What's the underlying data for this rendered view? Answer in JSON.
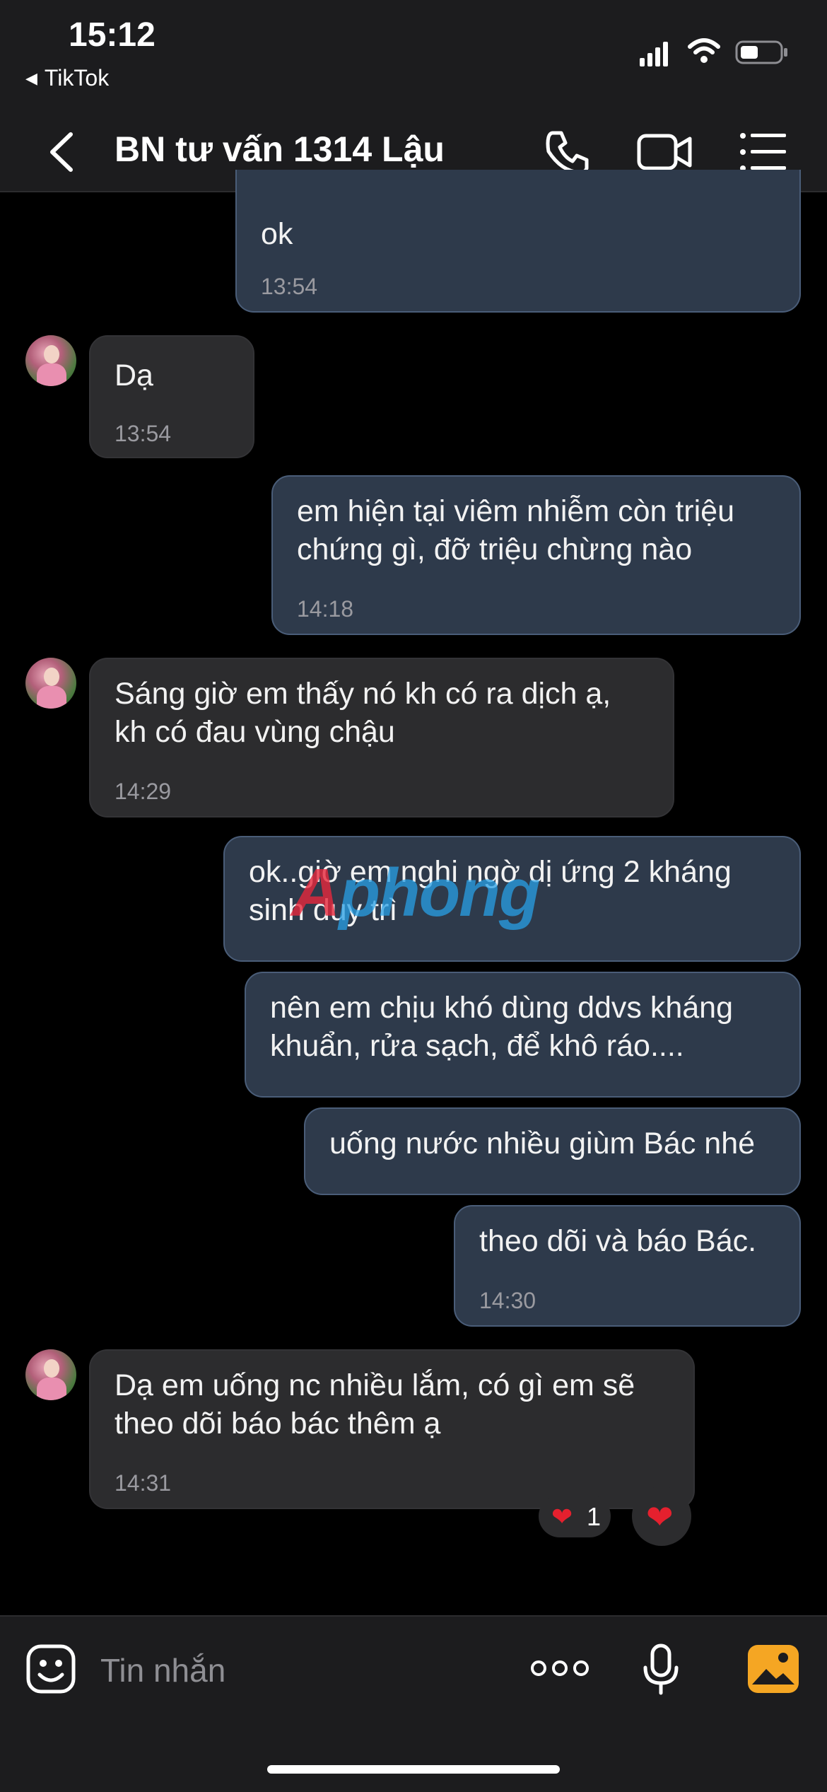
{
  "status_bar": {
    "time": "15:12",
    "back_app": "TikTok",
    "icons": [
      "cellular-signal-icon",
      "wifi-icon",
      "battery-icon"
    ]
  },
  "header": {
    "title": "BN tư vấn 1314 Lậu",
    "icons": [
      "back-chevron-icon",
      "phone-icon",
      "video-camera-icon",
      "list-menu-icon"
    ]
  },
  "messages": [
    {
      "sender": "me",
      "text": "ok",
      "time": "13:54"
    },
    {
      "sender": "contact",
      "text": "Dạ",
      "time": "13:54"
    },
    {
      "sender": "me",
      "text": "em hiện tại viêm nhiễm còn triệu\nchứng gì, đỡ triệu chừng nào",
      "time": "14:18"
    },
    {
      "sender": "contact",
      "text": "Sáng giờ em thấy nó kh có ra dịch ạ,\nkh có đau vùng chậu",
      "time": "14:29"
    },
    {
      "sender": "me",
      "text": "ok..giờ em nghi ngờ dị ứng 2 kháng\nsinh duy trì",
      "time": ""
    },
    {
      "sender": "me",
      "text": "nên em chịu khó dùng ddvs kháng\nkhuẩn, rửa sạch, để khô ráo....",
      "time": ""
    },
    {
      "sender": "me",
      "text": "uống nước nhiều giùm Bác nhé",
      "time": ""
    },
    {
      "sender": "me",
      "text": "theo dõi và báo Bác.",
      "time": "14:30"
    },
    {
      "sender": "contact",
      "text": "Dạ em uống nc nhiều lắm, có gì em sẽ\ntheo dõi báo bác thêm ạ",
      "time": "14:31",
      "reaction_count": "1"
    }
  ],
  "watermark": {
    "text": "Aphong"
  },
  "composer": {
    "placeholder": "Tin nhắn"
  },
  "colors": {
    "background": "#000000",
    "outgoing_bubble": "#2e3a4b",
    "incoming_bubble": "#2c2c2e",
    "heart": "#e5202e",
    "photo_icon": "#f5a623"
  }
}
